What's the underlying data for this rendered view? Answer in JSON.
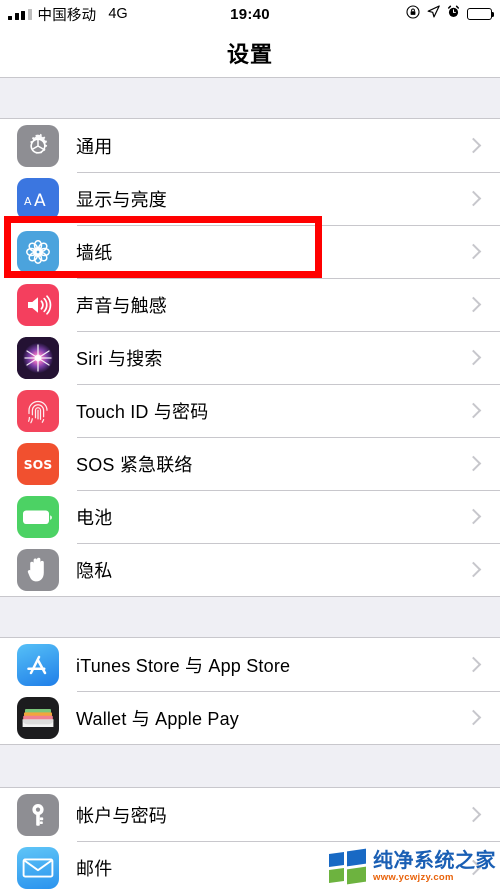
{
  "status_bar": {
    "carrier": "中国移动",
    "network": "4G",
    "time": "19:40",
    "signal_bars_filled": 3,
    "signal_bars_total": 4,
    "right_icons": [
      "rotation-lock-icon",
      "location-arrow-icon",
      "alarm-clock-icon",
      "battery-icon"
    ],
    "battery_level_percent": 100
  },
  "navbar": {
    "title": "设置"
  },
  "groups": [
    {
      "rows": [
        {
          "label": "通用",
          "icon": "gear-icon",
          "icon_color": "#8e8e93",
          "highlighted": false
        },
        {
          "label": "显示与亮度",
          "icon": "display-aa-icon",
          "icon_color": "#3b76e0",
          "highlighted": false
        },
        {
          "label": "墙纸",
          "icon": "wallpaper-icon",
          "icon_color": "#4ba3dd",
          "highlighted": true
        },
        {
          "label": "声音与触感",
          "icon": "sound-icon",
          "icon_color": "#f43f5e",
          "highlighted": false
        },
        {
          "label": "Siri 与搜索",
          "icon": "siri-icon",
          "icon_color": "#2b1b40",
          "highlighted": false
        },
        {
          "label": "Touch ID 与密码",
          "icon": "fingerprint-icon",
          "icon_color": "#f3455c",
          "highlighted": false
        },
        {
          "label": "SOS 紧急联络",
          "icon": "sos-icon",
          "icon_color": "#f1502f",
          "highlighted": false
        },
        {
          "label": "电池",
          "icon": "battery-icon",
          "icon_color": "#4cd264",
          "highlighted": false
        },
        {
          "label": "隐私",
          "icon": "privacy-hand-icon",
          "icon_color": "#8e8e93",
          "highlighted": false
        }
      ]
    },
    {
      "rows": [
        {
          "label": "iTunes Store 与 App Store",
          "icon": "app-store-icon",
          "icon_color": "#2e9bf0",
          "highlighted": false
        },
        {
          "label": "Wallet 与 Apple Pay",
          "icon": "wallet-icon",
          "icon_color": "#1c1c1e",
          "highlighted": false
        }
      ]
    },
    {
      "rows": [
        {
          "label": "帐户与密码",
          "icon": "key-icon",
          "icon_color": "#8e8e93",
          "highlighted": false
        },
        {
          "label": "邮件",
          "icon": "mail-icon",
          "icon_color": "#42a5f5",
          "highlighted": false
        }
      ]
    }
  ],
  "highlight": {
    "color": "#ff0000",
    "target_label": "墙纸"
  },
  "watermark": {
    "brand": "纯净系统之家",
    "url": "www.ycwjzy.com",
    "brand_color": "#1a5fb4",
    "url_color": "#e8620a"
  }
}
